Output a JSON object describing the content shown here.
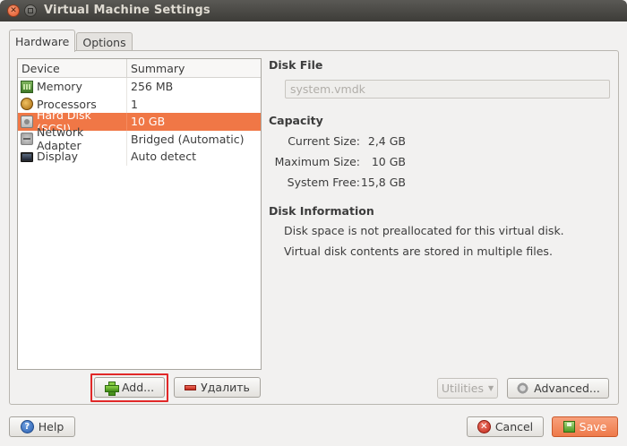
{
  "window": {
    "title": "Virtual Machine Settings",
    "close_glyph": "✕"
  },
  "tabs": [
    {
      "label": "Hardware",
      "active": true
    },
    {
      "label": "Options",
      "active": false
    }
  ],
  "device_list": {
    "columns": [
      "Device",
      "Summary"
    ],
    "rows": [
      {
        "device": "Memory",
        "summary": "256 MB",
        "icon": "memory-icon",
        "selected": false
      },
      {
        "device": "Processors",
        "summary": "1",
        "icon": "processor-icon",
        "selected": false
      },
      {
        "device": "Hard Disk (SCSI)",
        "summary": "10 GB",
        "icon": "hard-disk-icon",
        "selected": true
      },
      {
        "device": "Network Adapter",
        "summary": "Bridged (Automatic)",
        "icon": "network-adapter-icon",
        "selected": false
      },
      {
        "device": "Display",
        "summary": "Auto detect",
        "icon": "display-icon",
        "selected": false
      }
    ]
  },
  "list_buttons": {
    "add_label": "Add...",
    "remove_label": "Удалить"
  },
  "disk_file": {
    "title": "Disk File",
    "value": "system.vmdk"
  },
  "capacity": {
    "title": "Capacity",
    "current_label": "Current Size:",
    "current_value": "2,4 GB",
    "maximum_label": "Maximum Size:",
    "maximum_value": "10 GB",
    "free_label": "System Free:",
    "free_value": "15,8 GB"
  },
  "disk_information": {
    "title": "Disk Information",
    "line1": "Disk space is not preallocated for this virtual disk.",
    "line2": "Virtual disk contents are stored in multiple files."
  },
  "disk_buttons": {
    "utilities_label": "Utilities",
    "advanced_label": "Advanced..."
  },
  "footer": {
    "help_label": "Help",
    "cancel_label": "Cancel",
    "save_label": "Save"
  },
  "colors": {
    "selection": "#f07746",
    "highlight_box": "#e12828",
    "save_button": "#ee7a4a"
  }
}
